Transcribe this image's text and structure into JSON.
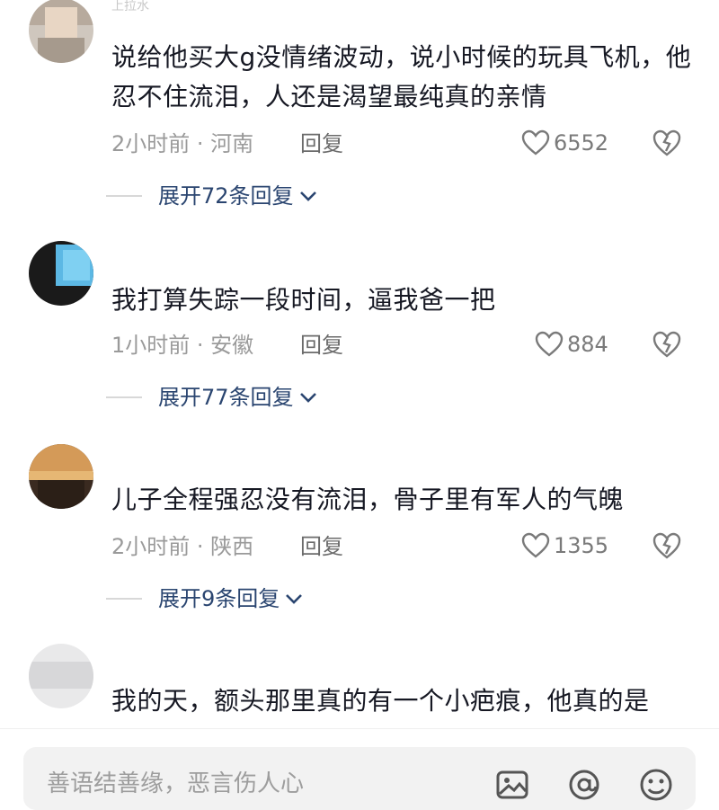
{
  "comments": [
    {
      "username": "上拉水",
      "text": "说给他买大g没情绪波动，说小时候的玩具飞机，他忍不住流泪，人还是渴望最纯真的亲情",
      "time_location": "2小时前 · 河南",
      "reply": "回复",
      "likes": "6552",
      "expand": "展开72条回复"
    },
    {
      "username": "",
      "text": "我打算失踪一段时间，逼我爸一把",
      "time_location": "1小时前 · 安徽",
      "reply": "回复",
      "likes": "884",
      "expand": "展开77条回复"
    },
    {
      "username": "",
      "text": "儿子全程强忍没有流泪，骨子里有军人的气魄",
      "time_location": "2小时前 · 陕西",
      "reply": "回复",
      "likes": "1355",
      "expand": "展开9条回复"
    },
    {
      "username": "",
      "text": "我的天，额头那里真的有一个小疤痕，他真的是"
    }
  ],
  "input": {
    "placeholder": "善语结善缘，恶言伤人心"
  },
  "icons": [
    "heart-icon",
    "broken-heart-icon",
    "chevron-down-icon",
    "image-icon",
    "at-icon",
    "emoji-icon"
  ],
  "colors": {
    "text": "#161823",
    "meta": "#9a9a9a",
    "expand": "#2a4570",
    "input_bg": "#f2f2f2"
  }
}
